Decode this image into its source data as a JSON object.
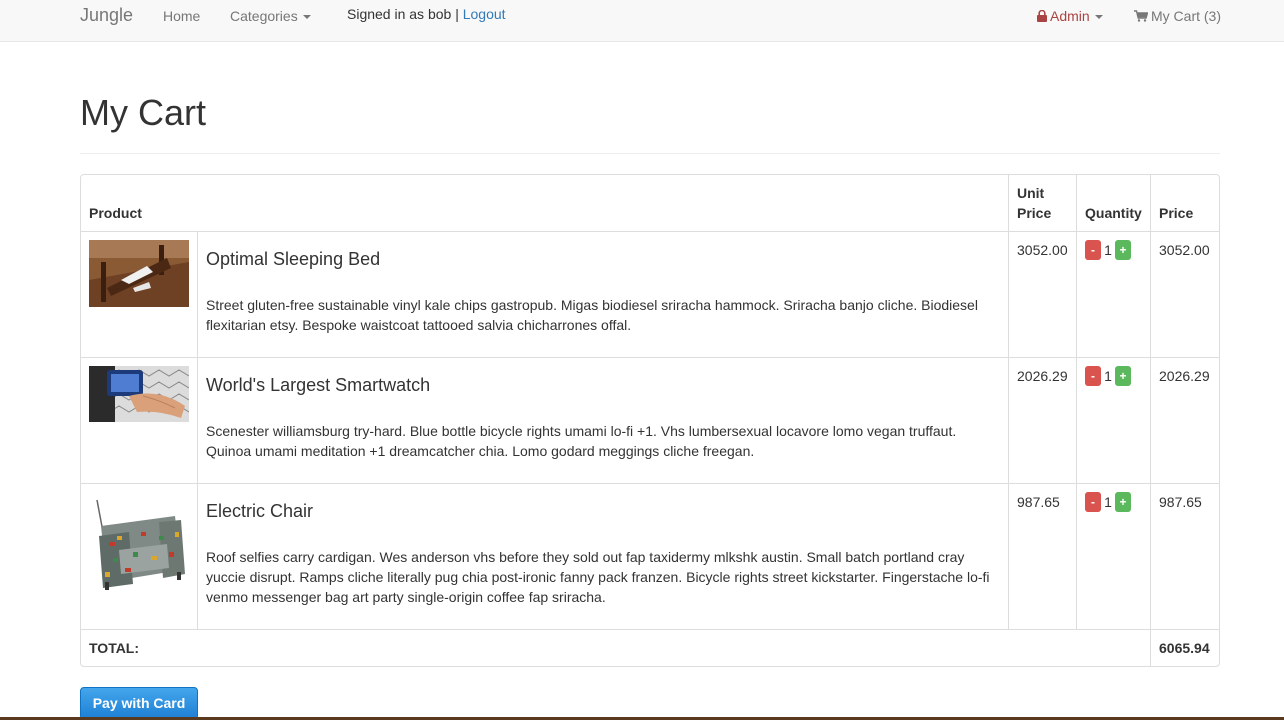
{
  "navbar": {
    "brand": "Jungle",
    "home": "Home",
    "categories": "Categories",
    "signed_in_text": "Signed in as bob |",
    "logout": "Logout",
    "admin": "Admin",
    "my_cart": "My Cart (3)",
    "lock_icon": "lock-icon",
    "cart_icon": "shopping-cart-icon",
    "admin_color": "#a94442",
    "link_color": "#337ab7"
  },
  "page": {
    "title": "My Cart"
  },
  "table": {
    "headers": {
      "product": "Product",
      "unit_price": "Unit Price",
      "quantity": "Quantity",
      "price": "Price"
    },
    "items": [
      {
        "name": "Optimal Sleeping Bed",
        "description": "Street gluten-free sustainable vinyl kale chips gastropub. Migas biodiesel sriracha hammock. Sriracha banjo cliche. Biodiesel flexitarian etsy. Bespoke waistcoat tattooed salvia chicharrones offal.",
        "unit_price": "3052.00",
        "quantity": "1",
        "price": "3052.00"
      },
      {
        "name": "World's Largest Smartwatch",
        "description": "Scenester williamsburg try-hard. Blue bottle bicycle rights umami lo-fi +1. Vhs lumbersexual locavore lomo vegan truffaut. Quinoa umami meditation +1 dreamcatcher chia. Lomo godard meggings cliche freegan.",
        "unit_price": "2026.29",
        "quantity": "1",
        "price": "2026.29"
      },
      {
        "name": "Electric Chair",
        "description": "Roof selfies carry cardigan. Wes anderson vhs before they sold out fap taxidermy mlkshk austin. Small batch portland cray yuccie disrupt. Ramps cliche literally pug chia post-ironic fanny pack franzen. Bicycle rights street kickstarter. Fingerstache lo-fi venmo messenger bag art party single-origin coffee fap sriracha.",
        "unit_price": "987.65",
        "quantity": "1",
        "price": "987.65"
      }
    ],
    "minus_label": "-",
    "plus_label": "+",
    "total_label": "TOTAL:",
    "total_value": "6065.94"
  },
  "pay_button": "Pay with Card",
  "colors": {
    "minus": "#d9534f",
    "plus": "#5cb85c",
    "pay": "#1e7fd4"
  }
}
